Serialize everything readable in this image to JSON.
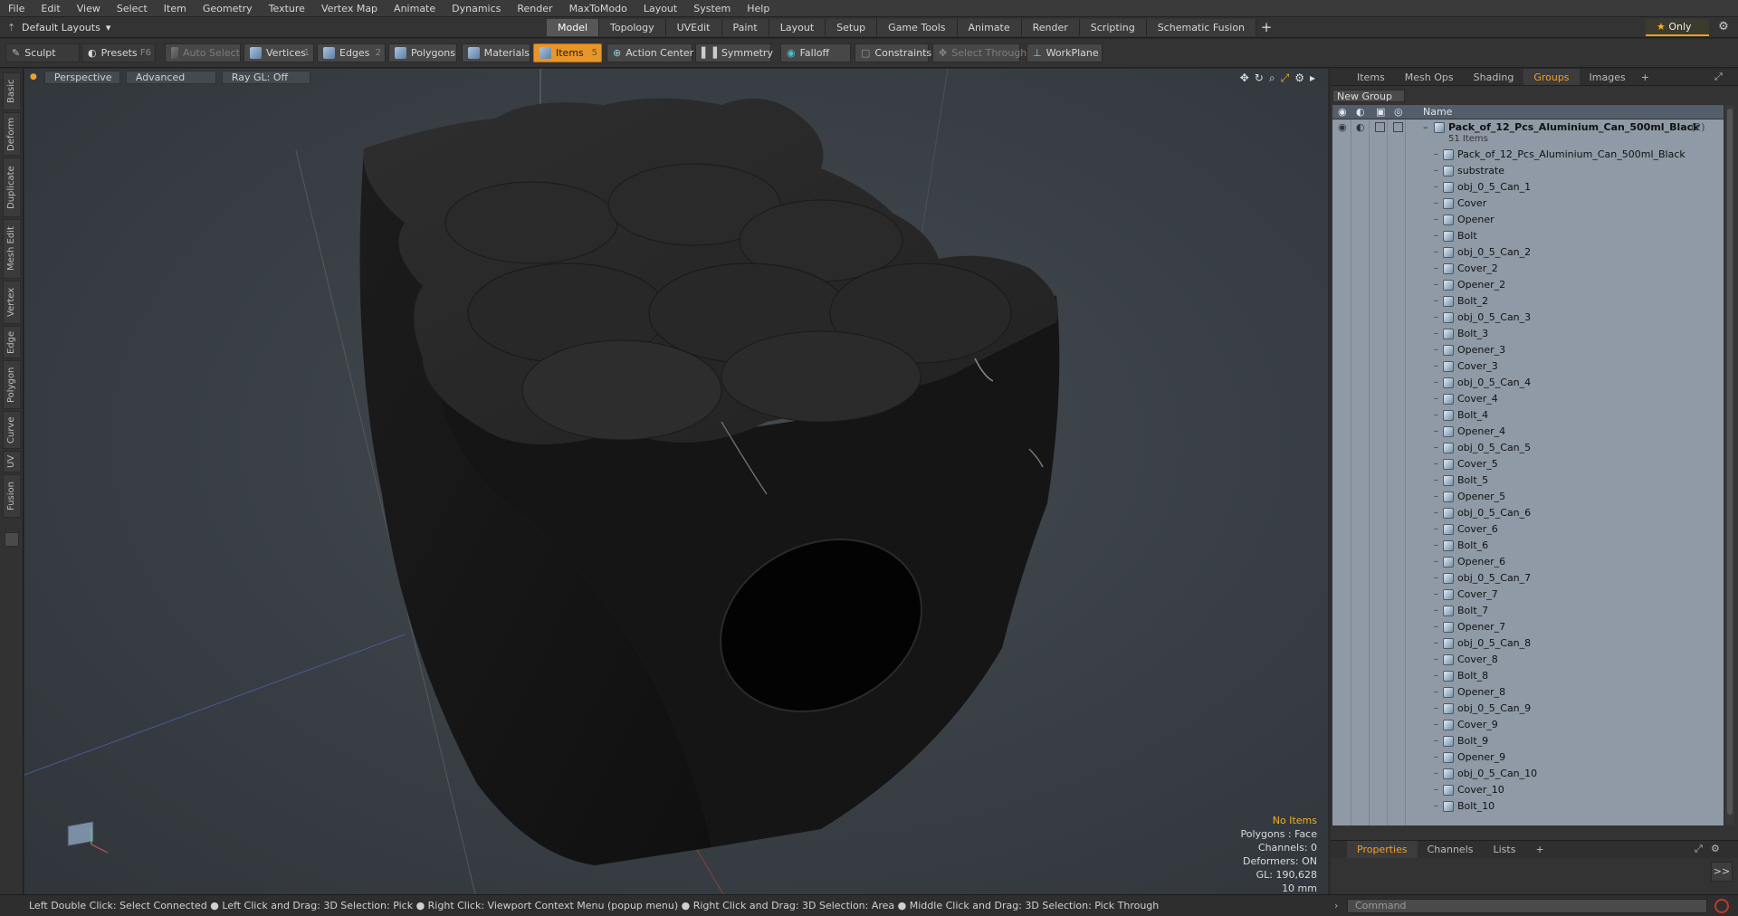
{
  "menu": [
    "File",
    "Edit",
    "View",
    "Select",
    "Item",
    "Geometry",
    "Texture",
    "Vertex Map",
    "Animate",
    "Dynamics",
    "Render",
    "MaxToModo",
    "Layout",
    "System",
    "Help"
  ],
  "layouts_label": "Default Layouts",
  "tabs": [
    "Model",
    "Topology",
    "UVEdit",
    "Paint",
    "Layout",
    "Setup",
    "Game Tools",
    "Animate",
    "Render",
    "Scripting",
    "Schematic Fusion"
  ],
  "active_tab": "Model",
  "only_label": "Only",
  "toolbar": {
    "sculpt": "Sculpt",
    "presets": "Presets",
    "presets_key": "F6",
    "auto_select": "Auto Select",
    "vertices": "Vertices",
    "vertices_key": "1",
    "edges": "Edges",
    "edges_key": "2",
    "polygons": "Polygons",
    "materials": "Materials",
    "items": "Items",
    "items_key": "5",
    "action_center": "Action Center",
    "symmetry": "Symmetry",
    "falloff": "Falloff",
    "constraints": "Constraints",
    "select_through": "Select Through",
    "workplane": "WorkPlane"
  },
  "left_tabs": [
    "Basic",
    "Deform",
    "Duplicate",
    "Mesh Edit",
    "Vertex",
    "Edge",
    "Polygon",
    "Curve",
    "UV",
    "Fusion"
  ],
  "viewport": {
    "perspective": "Perspective",
    "advanced": "Advanced",
    "raygl": "Ray GL: Off",
    "info": {
      "no_items": "No Items",
      "polygons": "Polygons : Face",
      "channels": "Channels: 0",
      "deformers": "Deformers: ON",
      "gl": "GL: 190,628",
      "scale": "10 mm"
    }
  },
  "right_tabs": [
    "Items",
    "Mesh Ops",
    "Shading",
    "Groups",
    "Images"
  ],
  "right_active": "Groups",
  "new_group": "New Group",
  "list_header": "Name",
  "group": {
    "name": "Pack_of_12_Pcs_Aluminium_Can_500ml_Black",
    "count": "(2)",
    "items_count": "51 Items"
  },
  "items": [
    "Pack_of_12_Pcs_Aluminium_Can_500ml_Black",
    "substrate",
    "obj_0_5_Can_1",
    "Cover",
    "Opener",
    "Bolt",
    "obj_0_5_Can_2",
    "Cover_2",
    "Opener_2",
    "Bolt_2",
    "obj_0_5_Can_3",
    "Bolt_3",
    "Opener_3",
    "Cover_3",
    "obj_0_5_Can_4",
    "Cover_4",
    "Bolt_4",
    "Opener_4",
    "obj_0_5_Can_5",
    "Cover_5",
    "Bolt_5",
    "Opener_5",
    "obj_0_5_Can_6",
    "Cover_6",
    "Bolt_6",
    "Opener_6",
    "obj_0_5_Can_7",
    "Cover_7",
    "Bolt_7",
    "Opener_7",
    "obj_0_5_Can_8",
    "Cover_8",
    "Bolt_8",
    "Opener_8",
    "obj_0_5_Can_9",
    "Cover_9",
    "Bolt_9",
    "Opener_9",
    "obj_0_5_Can_10",
    "Cover_10",
    "Bolt_10"
  ],
  "prop_tabs": [
    "Properties",
    "Channels",
    "Lists"
  ],
  "prop_active": "Properties",
  "status": "Left Double Click: Select Connected ● Left Click and Drag: 3D Selection: Pick ● Right Click: Viewport Context Menu (popup menu) ● Right Click and Drag: 3D Selection: Area ● Middle Click and Drag: 3D Selection: Pick Through",
  "command_placeholder": "Command",
  "colors": {
    "accent": "#e8962a",
    "list_bg": "#8f9aa6",
    "viewport_bg": "#3b4248"
  }
}
